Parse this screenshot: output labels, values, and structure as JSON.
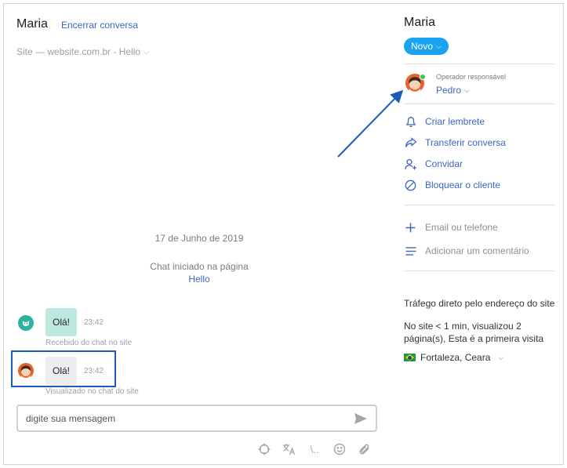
{
  "chat": {
    "contact_name": "Maria",
    "end_conversation": "Encerrar conversa",
    "site_info": "Site — website.com.br - Hello",
    "date_separator": "17 de Junho de 2019",
    "chat_started_text": "Chat iniciado na página",
    "chat_started_page": "Hello",
    "messages": [
      {
        "text": "Olá!",
        "time": "23:42",
        "status": "Recebido do chat no site"
      },
      {
        "text": "Olá!",
        "time": "23:42",
        "status": "Visualizado no chat do site"
      }
    ],
    "composer_placeholder": "digite sua mensagem",
    "toolbar_icons": [
      "crosshair-icon",
      "translate-icon",
      "shortcut-icon",
      "emoji-icon",
      "attach-icon"
    ],
    "toolbar_shortcut_text": "\\.."
  },
  "panel": {
    "contact_name": "Maria",
    "status_label": "Novo",
    "operator_label": "Operador responsável",
    "operator_name": "Pedro",
    "actions": [
      {
        "label": "Criar lembrete",
        "icon": "bell-icon"
      },
      {
        "label": "Transferir conversa",
        "icon": "forward-icon"
      },
      {
        "label": "Convidar",
        "icon": "add-user-icon"
      },
      {
        "label": "Bloquear o cliente",
        "icon": "block-icon"
      }
    ],
    "meta_actions": [
      {
        "label": "Email ou telefone",
        "icon": "plus-icon"
      },
      {
        "label": "Adicionar um comentário",
        "icon": "lines-icon"
      }
    ],
    "traffic_source": "Tráfego direto pelo endereço do site",
    "visit_info": "No site < 1 min, visualizou 2 página(s), Esta é a primeira visita",
    "location": "Fortaleza, Ceara"
  },
  "colors": {
    "accent_link": "#3c66c4",
    "status_pill": "#1aa3f0",
    "incoming_bubble": "#bde8e0",
    "outgoing_bubble": "#eeeef2",
    "highlight": "#1a5db8",
    "online": "#2ecc52"
  }
}
